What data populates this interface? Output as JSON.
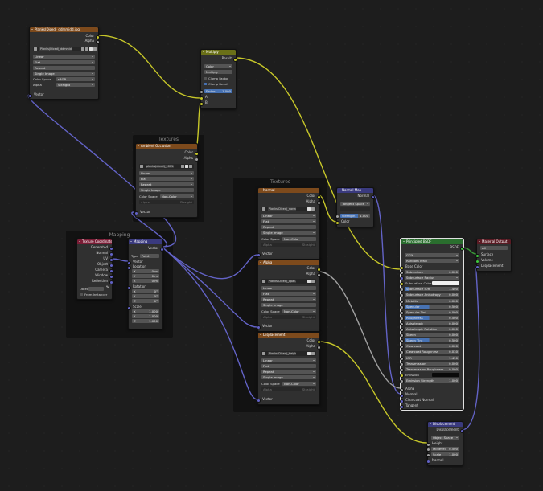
{
  "frames": {
    "textures_1": "Textures",
    "textures_2": "Textures",
    "mapping": "Mapping"
  },
  "sockets": {
    "color": "Color",
    "alpha": "Alpha",
    "vector": "Vector",
    "result": "Result",
    "a": "A",
    "b": "B",
    "factor": "Factor",
    "generated": "Generated",
    "normal": "Normal",
    "uv": "UV",
    "object": "Object",
    "camera": "Camera",
    "window": "Window",
    "reflection": "Reflection",
    "location": "Location",
    "rotation": "Rotation",
    "scale": "Scale",
    "height": "Height",
    "bsdf": "BSDF",
    "surface": "Surface",
    "volume": "Volume",
    "displacement": "Displacement",
    "base_color": "Base Color",
    "alpha_in": "Alpha",
    "normal_in": "Normal",
    "clearcoat_normal": "Clearcoat Normal",
    "tangent": "Tangent",
    "midlevel": "Midlevel"
  },
  "image_opts": {
    "linear": "Linear",
    "flat": "Flat",
    "repeat": "Repeat",
    "single_image": "Single Image",
    "color_space": "Color Space",
    "alpha": "Alpha",
    "srgb": "sRGB",
    "straight": "Straight",
    "non_color": "Non-Color"
  },
  "nodes": {
    "diffuse_tex": {
      "title": "Planks(Diced)_ddmmidd.jpg",
      "image": "Planks(Diced)_ddmmidd.jpg"
    },
    "multiply": {
      "title": "Multiply",
      "mode": "Color",
      "op": "Multiply",
      "clamp_result": "Clamp Result",
      "clamp_factor": "Clamp Factor",
      "factor_label": "Factor",
      "factor_value": "1.000"
    },
    "ao_tex": {
      "title": "Ambient Occlusion",
      "image": "planks(diced)_1001.jpg"
    },
    "tex_coord": {
      "title": "Texture Coordinate",
      "object_label": "Object",
      "from_instancer": "From Instancer"
    },
    "mapping": {
      "title": "Mapping",
      "type_label": "Type",
      "type_value": "Point",
      "x": "X",
      "y": "Y",
      "z": "Z",
      "loc": [
        "0 m",
        "0 m",
        "0 m"
      ],
      "rot": [
        "0°",
        "0°",
        "0°"
      ],
      "scl": [
        "1.000",
        "1.000",
        "1.000"
      ]
    },
    "normal_tex": {
      "title": "Normal",
      "image": "Planks(Diced)_norm..."
    },
    "alpha_tex": {
      "title": "Alpha",
      "image": "Planks(Diced)_opac..."
    },
    "disp_tex": {
      "title": "Displacement",
      "image": "Planks(Diced)_heigh..."
    },
    "normal_map": {
      "title": "Normal Map",
      "space": "Tangent Space",
      "strength_label": "Strength",
      "strength_value": "1.000"
    },
    "principled": {
      "title": "Principled BSDF",
      "dist": "GGX",
      "sss": "Random Walk",
      "rows": [
        {
          "label": "Subsurface",
          "value": "0.000",
          "kind": "fld"
        },
        {
          "label": "Subsurface Radius",
          "value": "",
          "kind": "drop"
        },
        {
          "label": "Subsurface Color",
          "value": "",
          "kind": "white"
        },
        {
          "label": "Subsurface IOR",
          "value": "1.400",
          "kind": "part",
          "f": "8%"
        },
        {
          "label": "Subsurface Anisotropy",
          "value": "0.000",
          "kind": "fld"
        },
        {
          "label": "Metallic",
          "value": "0.000",
          "kind": "fld"
        },
        {
          "label": "Specular",
          "value": "0.500",
          "kind": "part",
          "f": "45%"
        },
        {
          "label": "Specular Tint",
          "value": "0.000",
          "kind": "fld"
        },
        {
          "label": "Roughness",
          "value": "0.500",
          "kind": "part",
          "f": "45%"
        },
        {
          "label": "Anisotropic",
          "value": "0.000",
          "kind": "fld"
        },
        {
          "label": "Anisotropic Rotation",
          "value": "0.000",
          "kind": "fld"
        },
        {
          "label": "Sheen",
          "value": "0.000",
          "kind": "fld"
        },
        {
          "label": "Sheen Tint",
          "value": "0.500",
          "kind": "part",
          "f": "45%"
        },
        {
          "label": "Clearcoat",
          "value": "0.000",
          "kind": "fld"
        },
        {
          "label": "Clearcoat Roughness",
          "value": "0.030",
          "kind": "fld"
        },
        {
          "label": "IOR",
          "value": "1.450",
          "kind": "fld"
        },
        {
          "label": "Transmission",
          "value": "0.000",
          "kind": "fld"
        },
        {
          "label": "Transmission Roughness",
          "value": "0.000",
          "kind": "fld"
        },
        {
          "label": "Emission",
          "value": "",
          "kind": "black"
        },
        {
          "label": "Emission Strength",
          "value": "1.000",
          "kind": "fld"
        }
      ]
    },
    "output": {
      "title": "Material Output",
      "target": "All"
    },
    "displacement": {
      "title": "Displacement",
      "space": "Object Space",
      "mid_value": "0.500",
      "scale_value": "1.000"
    }
  },
  "colors": {
    "yellow": "#c7c729",
    "gray": "#a1a1a1",
    "purple": "#6363c7",
    "wire_green": "#3a9a3a"
  }
}
